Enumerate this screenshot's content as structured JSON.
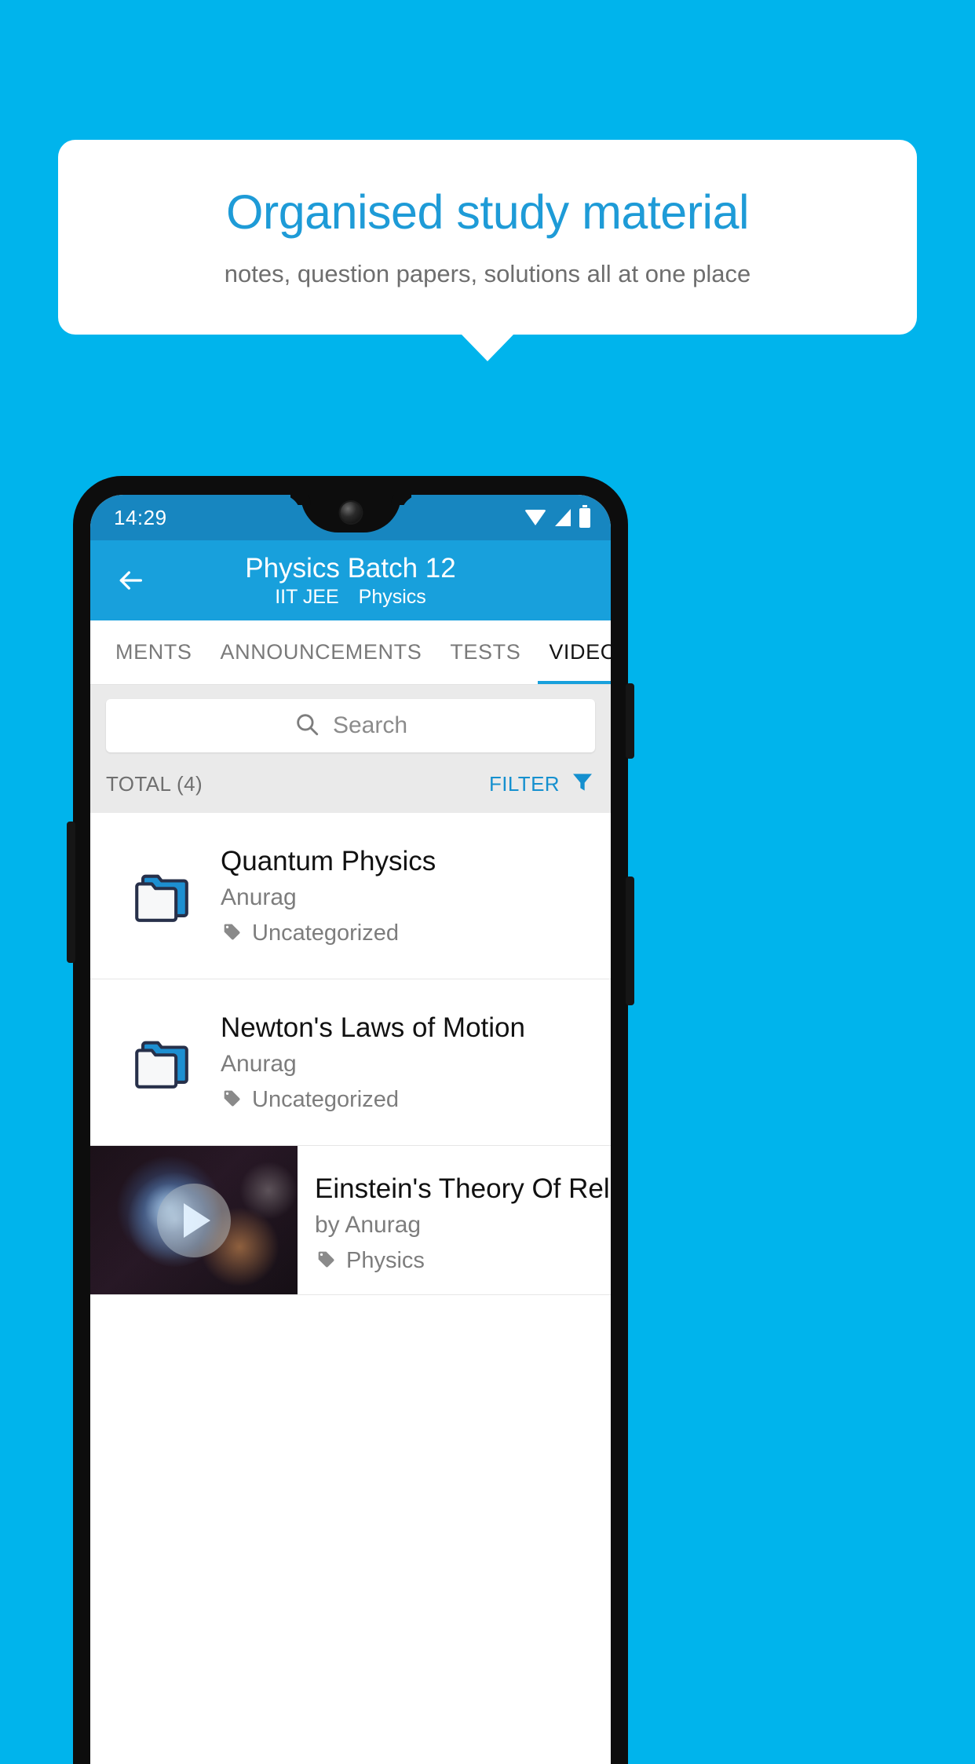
{
  "promo": {
    "title": "Organised study material",
    "subtitle": "notes, question papers, solutions all at one place",
    "title_color": "#1e9bd7",
    "background_color": "#00b4ec"
  },
  "phone": {
    "statusbar": {
      "time": "14:29",
      "icons": [
        "wifi-icon",
        "signal-icon",
        "battery-icon"
      ],
      "background_color": "#1786c0"
    },
    "appbar": {
      "back_icon": "back-arrow-icon",
      "title": "Physics Batch 12",
      "subtitle_exam": "IIT JEE",
      "subtitle_subject": "Physics",
      "background_color": "#18a0dc"
    },
    "tabs": [
      {
        "label": "MENTS",
        "active": false
      },
      {
        "label": "ANNOUNCEMENTS",
        "active": false
      },
      {
        "label": "TESTS",
        "active": false
      },
      {
        "label": "VIDEOS",
        "active": true
      }
    ],
    "search": {
      "placeholder": "Search",
      "icon": "search-icon",
      "value": ""
    },
    "listbar": {
      "total_label": "TOTAL (4)",
      "filter_label": "FILTER",
      "filter_icon": "filter-funnel-icon",
      "filter_color": "#1590cf"
    },
    "items": [
      {
        "type": "folder",
        "icon": "folder-icon",
        "title": "Quantum Physics",
        "author": "Anurag",
        "tag_icon": "tag-icon",
        "tag": "Uncategorized"
      },
      {
        "type": "folder",
        "icon": "folder-icon",
        "title": "Newton's Laws of Motion",
        "author": "Anurag",
        "tag_icon": "tag-icon",
        "tag": "Uncategorized"
      },
      {
        "type": "video",
        "icon": "video-thumbnail",
        "play_icon": "play-icon",
        "title": "Einstein's Theory Of Relativity",
        "author": "by Anurag",
        "tag_icon": "tag-icon",
        "tag": "Physics"
      }
    ]
  }
}
